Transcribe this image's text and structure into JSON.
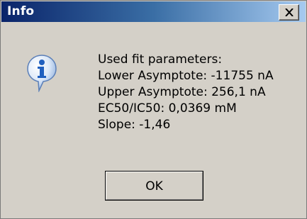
{
  "window": {
    "title": "Info",
    "close_glyph": "X",
    "title_gradient": [
      "#0a246a",
      "#a6caf0"
    ],
    "face_color": "#d4d0c8"
  },
  "icon": {
    "name": "info-icon",
    "glyph": "i",
    "color": "#1f5fbf"
  },
  "message": {
    "lines": [
      "Used fit parameters:",
      "Lower Asymptote: -11755 nA",
      "Upper Asymptote: 256,1 nA",
      "EC50/IC50: 0,0369 mM",
      "Slope: -1,46"
    ]
  },
  "buttons": {
    "ok_label": "OK"
  }
}
